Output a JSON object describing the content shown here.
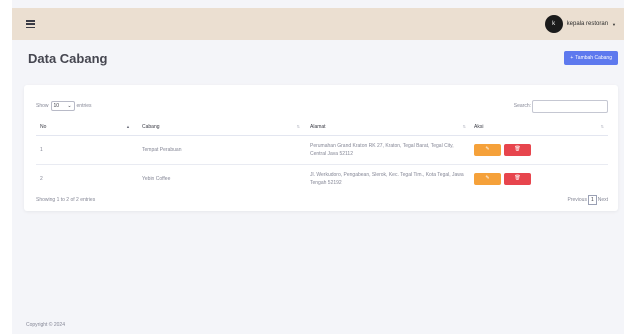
{
  "topbar": {
    "user_name": "kepala restoran",
    "avatar_text": "k"
  },
  "header": {
    "title": "Data Cabang",
    "add_button_icon": "plus-icon",
    "add_button_label": "Tambah Cabang"
  },
  "table_controls": {
    "show_label": "Show",
    "entries_value": "10",
    "entries_label": "entries",
    "search_label": "Search:",
    "search_value": ""
  },
  "table": {
    "headers": [
      "No",
      "Cabang",
      "Alamat",
      "Aksi"
    ],
    "rows": [
      {
        "no": "1",
        "cabang": "Tempat Perabuan",
        "alamat": "Perumahan Grand Kraton RK 27, Kraton, Tegal Barat, Tegal City, Central Java 52112"
      },
      {
        "no": "2",
        "cabang": "Yebin Coffee",
        "alamat": "Jl. Werkudoro, Pengabean, Slerok, Kec. Tegal Tim., Kota Tegal, Jawa Tengah 52192"
      }
    ]
  },
  "table_footer": {
    "info": "Showing 1 to 2 of 2 entries",
    "previous": "Previous",
    "page": "1",
    "next": "Next"
  },
  "footer": {
    "copyright": "Copyright © 2024"
  },
  "colors": {
    "topbar": "#ebdfd1",
    "primary": "#5e79ee",
    "edit": "#f5a13a",
    "delete": "#e7454d"
  }
}
